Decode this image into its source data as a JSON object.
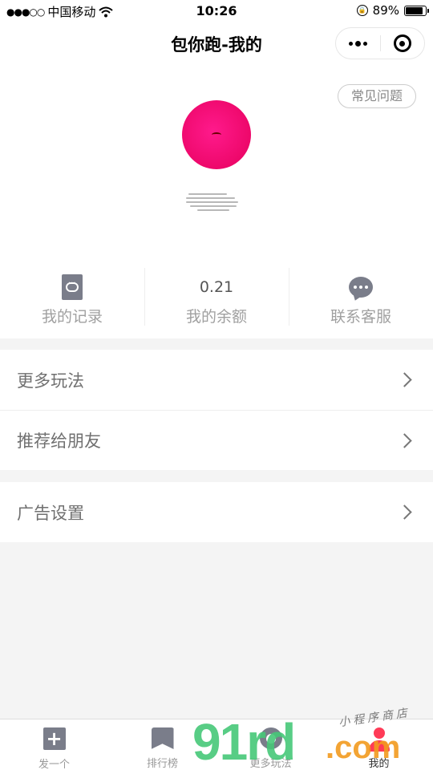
{
  "status_bar": {
    "signal": "●●●○○",
    "carrier": "中国移动",
    "wifi_icon": "wifi-icon",
    "time": "10:26",
    "battery_percent": "89%",
    "battery_level": 0.89
  },
  "nav": {
    "title": "包你跑-我的",
    "more_icon": "more-dots-icon",
    "close_icon": "target-close-icon"
  },
  "profile": {
    "faq_label": "常见问题",
    "avatar_color": "#ff1a8c"
  },
  "stats": [
    {
      "label": "我的记录",
      "icon": "record-icon"
    },
    {
      "label": "我的余额",
      "value": "0.21"
    },
    {
      "label": "联系客服",
      "icon": "chat-icon"
    }
  ],
  "menu": {
    "group1": [
      {
        "label": "更多玩法"
      },
      {
        "label": "推荐给朋友"
      }
    ],
    "group2": [
      {
        "label": "广告设置"
      }
    ]
  },
  "tabs": [
    {
      "label": "发一个",
      "icon": "plus-icon"
    },
    {
      "label": "排行榜",
      "icon": "bookmark-icon"
    },
    {
      "label": "更多玩法",
      "icon": "more-icon"
    },
    {
      "label": "我的",
      "icon": "user-icon",
      "active": true
    }
  ],
  "watermark": {
    "brand": "91rd",
    "suffix": ".com",
    "script": "小程序商店"
  },
  "colors": {
    "accent_red": "#ff3b57",
    "icon_gray": "#7a7d8a",
    "watermark_green": "#46c878",
    "watermark_orange": "#f29b1f"
  }
}
